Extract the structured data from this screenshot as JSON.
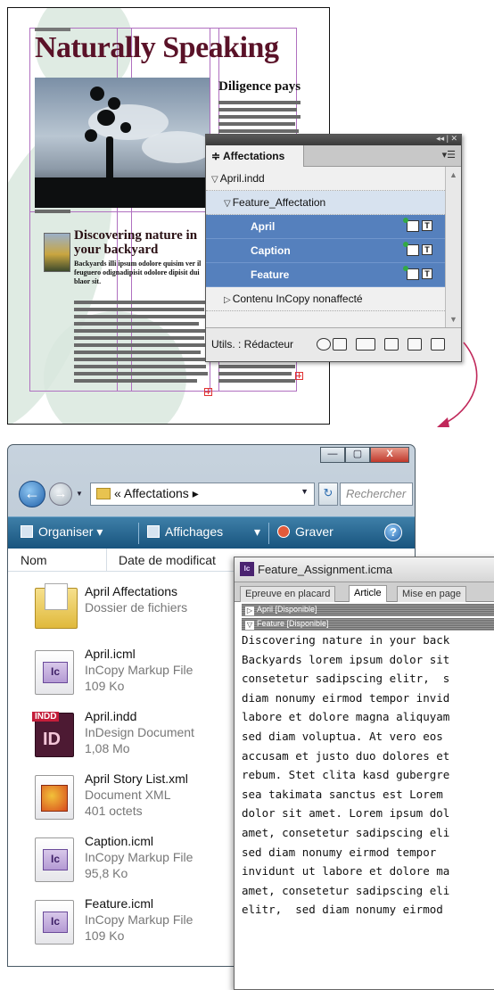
{
  "layout": {
    "title": "Naturally Speaking",
    "sidebar_title": "Diligence pays",
    "article_head": "Discovering nature in your backyard",
    "article_body": "Backyards illi ipsum odolore quisim ver il feuguero odignadipisit odolore dipisit dui blaor sit."
  },
  "panel": {
    "tab_label": "≑ Affectations",
    "window_controls": "◂◂ | ✕",
    "menu_icon": "panel-menu-icon",
    "rows": [
      {
        "label": "April.indd"
      },
      {
        "label": "Feature_Affectation"
      },
      {
        "label": "April"
      },
      {
        "label": "Caption"
      },
      {
        "label": "Feature"
      },
      {
        "label": "Contenu InCopy nonaffecté"
      }
    ],
    "user_label": "Utils. : Rédacteur",
    "selection_color": "#5580bd"
  },
  "explorer": {
    "address": "« Affectations ▸",
    "search_placeholder": "Rechercher",
    "toolbar": {
      "organize": "Organiser ▾",
      "views": "Affichages",
      "burn": "Graver",
      "help": "?"
    },
    "window_buttons": {
      "minimize": "—",
      "maximize": "▢",
      "close": "X"
    },
    "columns": {
      "name": "Nom",
      "date": "Date de modificat"
    },
    "files": [
      {
        "name": "April Affectations",
        "type": "Dossier de fichiers",
        "size": "",
        "icon": "folder-icon"
      },
      {
        "name": "April.icml",
        "type": "InCopy Markup File",
        "size": "109 Ko",
        "icon": "incopy-file-icon"
      },
      {
        "name": "April.indd",
        "type": "InDesign Document",
        "size": "1,08 Mo",
        "icon": "indesign-file-icon",
        "badge": "INDD",
        "label": "ID"
      },
      {
        "name": "April Story List.xml",
        "type": "Document XML",
        "size": "401 octets",
        "icon": "xml-file-icon"
      },
      {
        "name": "Caption.icml",
        "type": "InCopy Markup File",
        "size": "95,8 Ko",
        "icon": "incopy-file-icon"
      },
      {
        "name": "Feature.icml",
        "type": "InCopy Markup File",
        "size": "109 Ko",
        "icon": "incopy-file-icon"
      }
    ]
  },
  "icma": {
    "title": "Feature_Assignment.icma",
    "logo": "Ic",
    "tabs": [
      "Epreuve en placard",
      "Article",
      "Mise en page"
    ],
    "stories": [
      {
        "toggle": "▷",
        "label": "April [Disponible]"
      },
      {
        "toggle": "▽",
        "label": "Feature [Disponible]"
      }
    ],
    "text_lines": [
      "Discovering nature in your back",
      "Backyards lorem ipsum dolor sit",
      "consetetur sadipscing elitr,  s",
      "diam nonumy eirmod tempor invid",
      "labore et dolore magna aliquyam",
      "sed diam voluptua. At vero eos ",
      "accusam et justo duo dolores et",
      "rebum. Stet clita kasd gubergre",
      "sea takimata sanctus est Lorem ",
      "dolor sit amet. Lorem ipsum dol",
      "amet, consetetur sadipscing eli",
      "sed diam nonumy eirmod tempor ",
      "invidunt ut labore et dolore ma",
      "amet, consetetur sadipscing eli",
      "elitr,  sed diam nonumy eirmod "
    ]
  },
  "arrow_color": "#c0285a"
}
